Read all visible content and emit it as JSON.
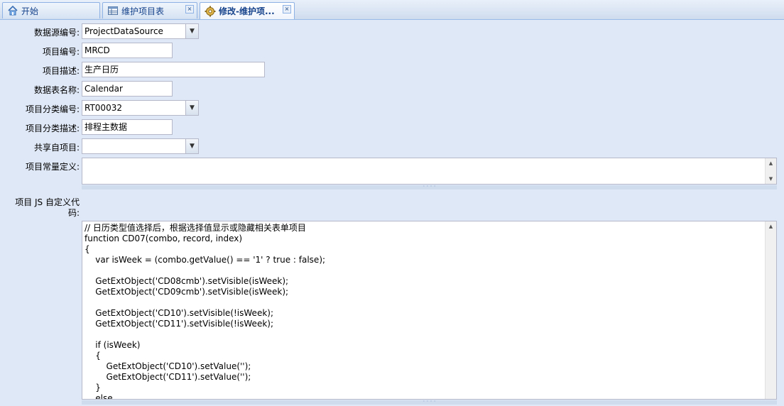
{
  "tabs": [
    {
      "label": "开始",
      "icon": "home-icon"
    },
    {
      "label": "维护项目表",
      "icon": "table-icon"
    },
    {
      "label": "修改-维护项...",
      "icon": "gear-icon"
    }
  ],
  "form": {
    "datasource": {
      "label": "数据源编号:",
      "value": "ProjectDataSource"
    },
    "item_code": {
      "label": "项目编号:",
      "value": "MRCD"
    },
    "item_desc": {
      "label": "项目描述:",
      "value": "生产日历"
    },
    "table_name": {
      "label": "数据表名称:",
      "value": "Calendar"
    },
    "category_code": {
      "label": "项目分类编号:",
      "value": "RT00032"
    },
    "category_desc": {
      "label": "项目分类描述:",
      "value": "排程主数据"
    },
    "shared_from": {
      "label": "共享自项目:",
      "value": ""
    },
    "constants": {
      "label": "项目常量定义:",
      "value": ""
    },
    "js_code": {
      "label_line1": "项目 JS 自定义代",
      "label_line2": "码:",
      "value": "// 日历类型值选择后，根据选择值显示或隐藏相关表单项目\nfunction CD07(combo, record, index)\n{\n    var isWeek = (combo.getValue() == '1' ? true : false);\n\n    GetExtObject('CD08cmb').setVisible(isWeek);\n    GetExtObject('CD09cmb').setVisible(isWeek);\n\n    GetExtObject('CD10').setVisible(!isWeek);\n    GetExtObject('CD11').setVisible(!isWeek);\n\n    if (isWeek)\n    {\n        GetExtObject('CD10').setValue('');\n        GetExtObject('CD11').setValue('');\n    }\n    else"
    }
  },
  "colors": {
    "background": "#dfe8f6",
    "tab_border": "#8db2e3",
    "tab_text": "#15428b",
    "field_border": "#b5b8c8"
  }
}
